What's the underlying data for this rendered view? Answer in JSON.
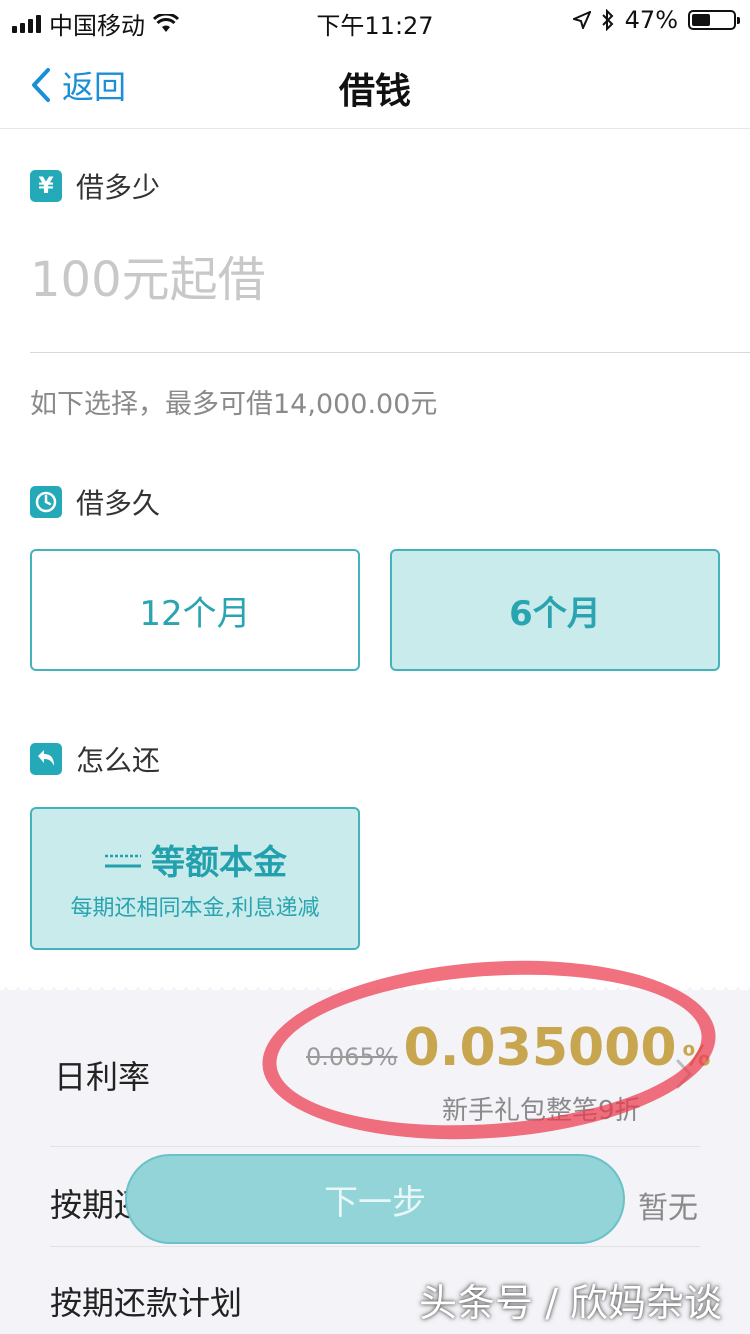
{
  "status_bar": {
    "carrier": "中国移动",
    "time": "下午11:27",
    "battery": "47%",
    "battery_level": 0.47
  },
  "nav": {
    "back_label": "返回",
    "title": "借钱"
  },
  "amount_section": {
    "icon": "yen-icon",
    "icon_glyph": "¥",
    "title": "借多少",
    "placeholder": "100元起借",
    "hint": "如下选择，最多可借14,000.00元"
  },
  "term_section": {
    "icon": "clock-icon",
    "title": "借多久",
    "options": [
      {
        "label": "12个月",
        "selected": false
      },
      {
        "label": "6个月",
        "selected": true
      }
    ]
  },
  "repay_section": {
    "icon": "return-arrow-icon",
    "title": "怎么还",
    "option_title": "等额本金",
    "option_desc": "每期还相同本金,利息递减"
  },
  "summary": {
    "daily_rate_label": "日利率",
    "old_rate": "0.065%",
    "new_rate": "0.035000",
    "rate_pct": "%",
    "gift_note": "新手礼包整笔9折",
    "per_period_label": "按期还",
    "per_period_value": "暂无",
    "plan_label": "按期还款计划"
  },
  "next_button": "下一步",
  "watermark": "头条号 / 欣妈杂谈",
  "colors": {
    "accent": "#23a9b7",
    "rate": "#c8a64f",
    "back": "#1a8fd8",
    "annotation": "#ec3a4e"
  }
}
